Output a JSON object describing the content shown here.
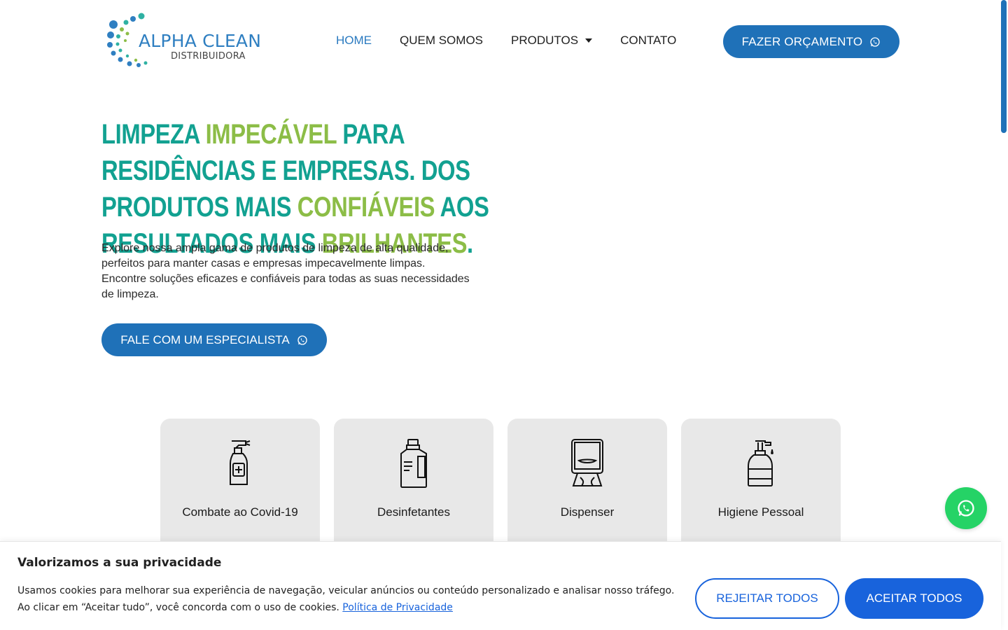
{
  "brand": {
    "name": "ALPHA CLEAN",
    "subtitle": "DISTRIBUIDORA",
    "primary_color": "#1f71b8",
    "teal": "#12a191",
    "green": "#8cbd47"
  },
  "nav": {
    "items": [
      {
        "label": "HOME",
        "active": true
      },
      {
        "label": "QUEM SOMOS",
        "active": false
      },
      {
        "label": "PRODUTOS",
        "active": false,
        "has_dropdown": true
      },
      {
        "label": "CONTATO",
        "active": false
      }
    ],
    "cta_label": "FAZER ORÇAMENTO",
    "cta_icon": "whatsapp-icon"
  },
  "hero": {
    "title_parts": [
      {
        "text": "LIMPEZA ",
        "highlight": false
      },
      {
        "text": "IMPECÁVEL",
        "highlight": true
      },
      {
        "text": " PARA RESIDÊNCIAS E EMPRESAS. DOS PRODUTOS MAIS ",
        "highlight": false
      },
      {
        "text": "CONFIÁVEIS",
        "highlight": true
      },
      {
        "text": " AOS RESULTADOS MAIS ",
        "highlight": false
      },
      {
        "text": "BRILHANTES",
        "highlight": true
      },
      {
        "text": ".",
        "highlight": false
      }
    ],
    "description": "Explore nossa ampla gama de produtos de limpeza de alta qualidade, perfeitos para manter casas e empresas impecavelmente limpas. Encontre soluções eficazes e confiáveis para todas as suas necessidades de limpeza.",
    "cta_label": "FALE COM UM ESPECIALISTA",
    "cta_icon": "whatsapp-icon"
  },
  "categories": [
    {
      "label": "Combate ao Covid-19",
      "icon": "spray-bottle-icon"
    },
    {
      "label": "Desinfetantes",
      "icon": "detergent-jug-icon"
    },
    {
      "label": "Dispenser",
      "icon": "paper-towel-dispenser-icon"
    },
    {
      "label": "Higiene Pessoal",
      "icon": "soap-pump-icon"
    }
  ],
  "floating": {
    "icon": "whatsapp-icon",
    "color": "#25d366"
  },
  "cookie": {
    "title": "Valorizamos a sua privacidade",
    "text_line1": "Usamos cookies para melhorar sua experiência de navegação, veicular anúncios ou conteúdo personalizado e analisar nosso tráfego.",
    "text_line2": "Ao clicar em “Aceitar tudo”, você concorda com o uso de cookies. ",
    "link_label": "Política de Privacidade",
    "reject_label": "REJEITAR TODOS",
    "accept_label": "ACEITAR TODOS",
    "accent": "#1863dc"
  }
}
